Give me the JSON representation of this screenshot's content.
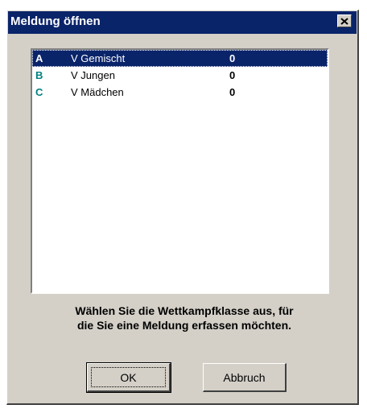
{
  "window": {
    "title": "Meldung öffnen",
    "close_icon": "close-icon"
  },
  "list": {
    "items": [
      {
        "code": "A",
        "name": "V Gemischt",
        "value": "0",
        "selected": true
      },
      {
        "code": "B",
        "name": "V Jungen",
        "value": "0",
        "selected": false
      },
      {
        "code": "C",
        "name": "V Mädchen",
        "value": "0",
        "selected": false
      }
    ]
  },
  "instruction": {
    "line1": "Wählen Sie die Wettkampfklasse aus, für",
    "line2": "die Sie eine Meldung erfassen möchten."
  },
  "buttons": {
    "ok_label": "OK",
    "cancel_label": "Abbruch"
  },
  "colors": {
    "titlebar": "#0a246a",
    "selection": "#0a246a",
    "code_accent": "#008080",
    "face": "#d4d0c8"
  }
}
